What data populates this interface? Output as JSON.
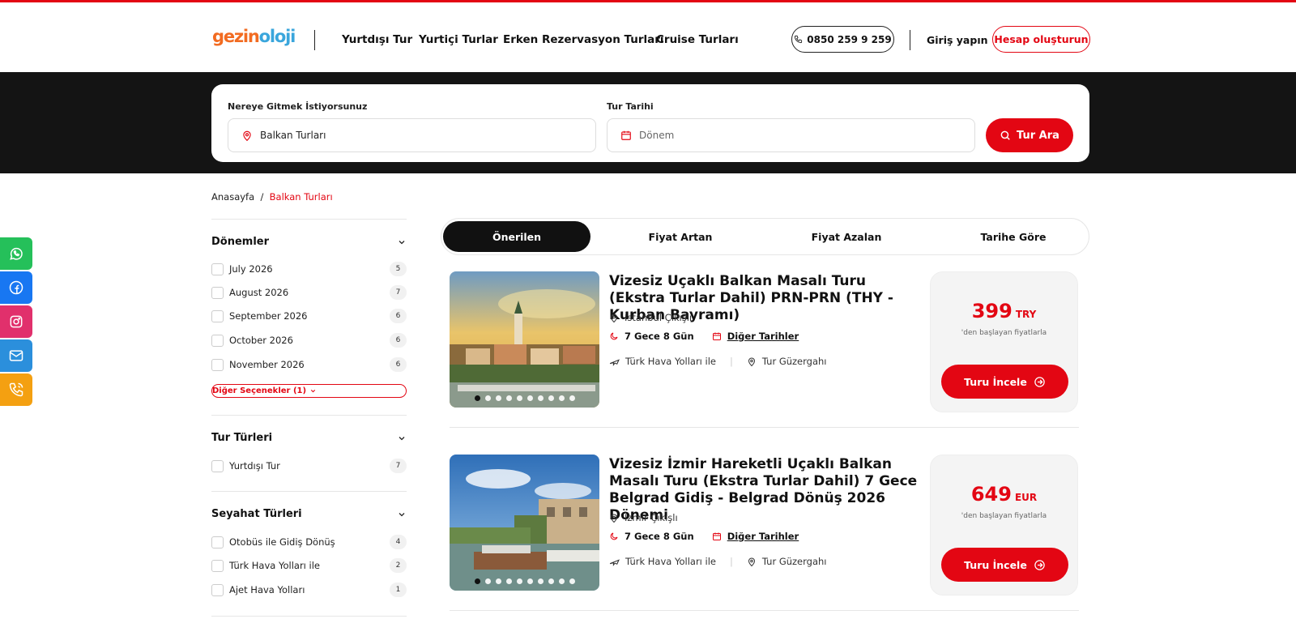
{
  "header": {
    "logo_part1": "gezin",
    "logo_part2": "oloji",
    "nav": [
      "Yurtdışı Tur",
      "Yurtiçi Turlar",
      "Erken Rezervasyon Turları",
      "Cruise Turları"
    ],
    "phone": "0850 259 9 259",
    "login": "Giriş yapın",
    "register": "Hesap oluşturun"
  },
  "search": {
    "dest_label": "Nereye Gitmek İstiyorsunuz",
    "dest_value": "Balkan Turları",
    "date_label": "Tur Tarihi",
    "date_placeholder": "Dönem",
    "button": "Tur Ara"
  },
  "breadcrumb": {
    "home": "Anasayfa",
    "separator": "/",
    "current": "Balkan Turları"
  },
  "social": [
    {
      "name": "whatsapp-icon",
      "color": "#25c05a"
    },
    {
      "name": "facebook-icon",
      "color": "#1877f2"
    },
    {
      "name": "instagram-icon",
      "color": "#e1306c"
    },
    {
      "name": "email-icon",
      "color": "#2b8fdc"
    },
    {
      "name": "phone-icon",
      "color": "#f4a011"
    }
  ],
  "filters": {
    "donemler": {
      "title": "Dönemler",
      "items": [
        {
          "label": "July 2026",
          "count": "5"
        },
        {
          "label": "August 2026",
          "count": "7"
        },
        {
          "label": "September 2026",
          "count": "6"
        },
        {
          "label": "October 2026",
          "count": "6"
        },
        {
          "label": "November 2026",
          "count": "6"
        }
      ],
      "more": "Diğer Seçenekler (1)"
    },
    "tur_turleri": {
      "title": "Tur Türleri",
      "items": [
        {
          "label": "Yurtdışı Tur",
          "count": "7"
        }
      ]
    },
    "seyahat_turleri": {
      "title": "Seyahat Türleri",
      "items": [
        {
          "label": "Otobüs ile Gidiş Dönüş",
          "count": "4"
        },
        {
          "label": "Türk Hava Yolları ile",
          "count": "2"
        },
        {
          "label": "Ajet Hava Yolları",
          "count": "1"
        }
      ]
    }
  },
  "sort": [
    "Önerilen",
    "Fiyat Artan",
    "Fiyat Azalan",
    "Tarihe Göre"
  ],
  "sort_active": "Önerilen",
  "tours": [
    {
      "title": "Vizesiz Uçaklı Balkan Masalı Turu (Ekstra Turlar Dahil) PRN-PRN (THY - Kurban Bayramı)",
      "departure": "İstanbul Çıkışlı",
      "duration": "7 Gece 8 Gün",
      "other_dates": "Diğer Tarihler",
      "airline": "Türk Hava Yolları ile",
      "route": "Tur Güzergahı",
      "price": "399",
      "currency": "TRY",
      "price_note": "'den başlayan fiyatlarla",
      "cta": "Turu İncele"
    },
    {
      "title": "Vizesiz İzmir Hareketli Uçaklı Balkan Masalı Turu (Ekstra Turlar Dahil) 7 Gece Belgrad Gidiş - Belgrad Dönüş 2026 Dönemi",
      "departure": "İzmir Çıkışlı",
      "duration": "7 Gece 8 Gün",
      "other_dates": "Diğer Tarihler",
      "airline": "Türk Hava Yolları ile",
      "route": "Tur Güzergahı",
      "price": "649",
      "currency": "EUR",
      "price_note": "'den başlayan fiyatlarla",
      "cta": "Turu İncele"
    }
  ],
  "colors": {
    "brand_red": "#e30613",
    "hero_bg": "#141414"
  }
}
